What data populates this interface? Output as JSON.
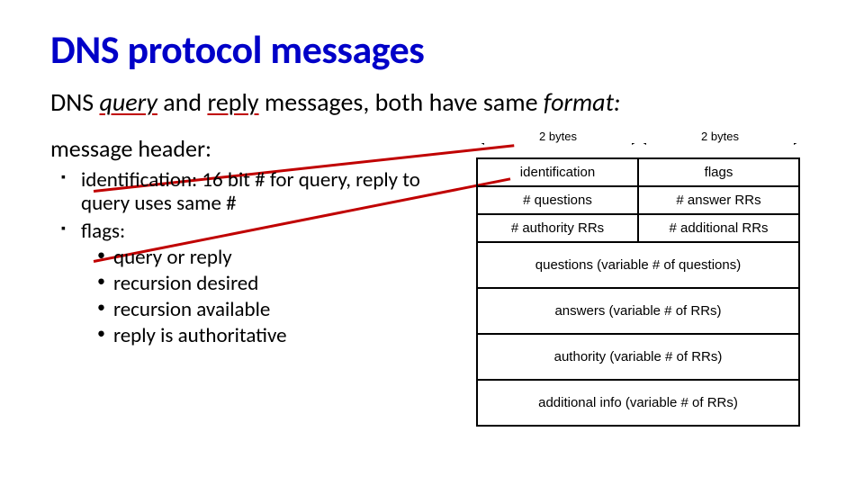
{
  "title": "DNS protocol messages",
  "subtitle": {
    "pre": "DNS ",
    "query": "query",
    "mid1": " and ",
    "reply": "reply",
    "mid2": " messages, both have same  ",
    "format": "format:"
  },
  "left": {
    "header": "message header:",
    "b1": "identification: 16 bit # for query, reply to query uses same #",
    "b2": "flags:",
    "sub": [
      "query or reply",
      "recursion desired",
      "recursion available",
      "reply is authoritative"
    ]
  },
  "bytes": "2 bytes",
  "pkt": {
    "r1a": "identification",
    "r1b": "flags",
    "r2a": "# questions",
    "r2b": "# answer RRs",
    "r3a": "# authority RRs",
    "r3b": "# additional RRs",
    "r4": "questions (variable # of questions)",
    "r5": "answers (variable # of RRs)",
    "r6": "authority (variable # of RRs)",
    "r7": "additional info (variable # of RRs)"
  }
}
